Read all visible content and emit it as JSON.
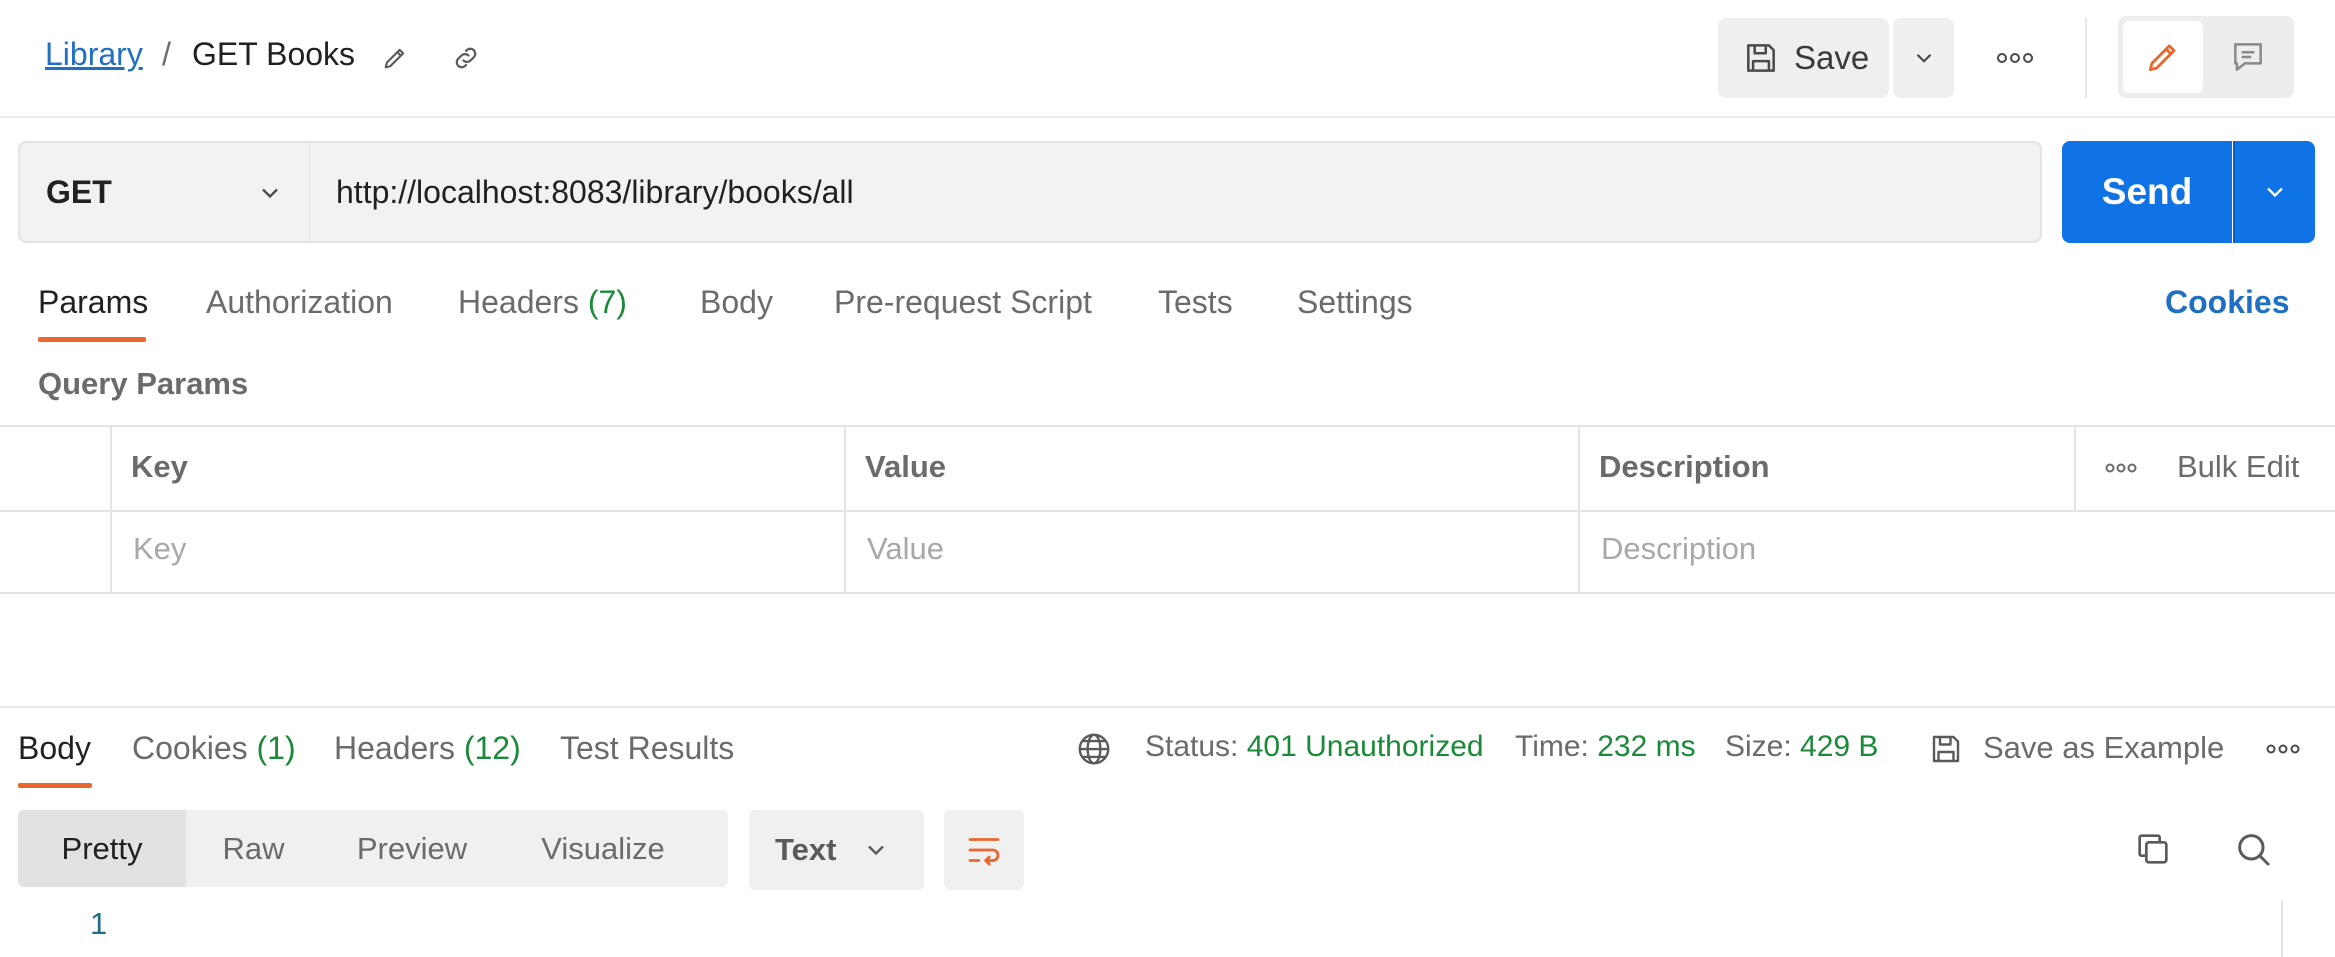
{
  "header": {
    "breadcrumb_parent": "Library",
    "breadcrumb_separator": "/",
    "request_name": "GET Books",
    "save_label": "Save",
    "icons": [
      "pencil-icon",
      "link-icon",
      "save-icon",
      "chevron-down-icon",
      "more-icon",
      "edit-mode-icon",
      "comment-icon"
    ]
  },
  "request": {
    "method": "GET",
    "url": "http://localhost:8083/library/books/all",
    "send_label": "Send"
  },
  "request_tabs": {
    "params": "Params",
    "authorization": "Authorization",
    "headers": "Headers",
    "headers_count": "(7)",
    "body": "Body",
    "pre_request_script": "Pre-request Script",
    "tests": "Tests",
    "settings": "Settings",
    "cookies": "Cookies",
    "active": "Params"
  },
  "query_params": {
    "section_label": "Query Params",
    "columns": [
      "Key",
      "Value",
      "Description"
    ],
    "bulk_edit_label": "Bulk Edit",
    "placeholders": {
      "key": "Key",
      "value": "Value",
      "description": "Description"
    }
  },
  "response": {
    "tabs": {
      "body": "Body",
      "cookies": "Cookies",
      "cookies_count": "(1)",
      "headers": "Headers",
      "headers_count": "(12)",
      "test_results": "Test Results",
      "active": "Body"
    },
    "status_label": "Status:",
    "status_value": "401 Unauthorized",
    "time_label": "Time:",
    "time_value": "232 ms",
    "size_label": "Size:",
    "size_value": "429 B",
    "save_as_example": "Save as Example",
    "views": [
      "Pretty",
      "Raw",
      "Preview",
      "Visualize"
    ],
    "active_view": "Pretty",
    "format": "Text",
    "line_numbers": [
      "1"
    ]
  },
  "colors": {
    "accent_orange": "#e8672f",
    "send_blue": "#0f72e5",
    "link_blue": "#1f6fc5",
    "count_green": "#1a8a3a"
  }
}
